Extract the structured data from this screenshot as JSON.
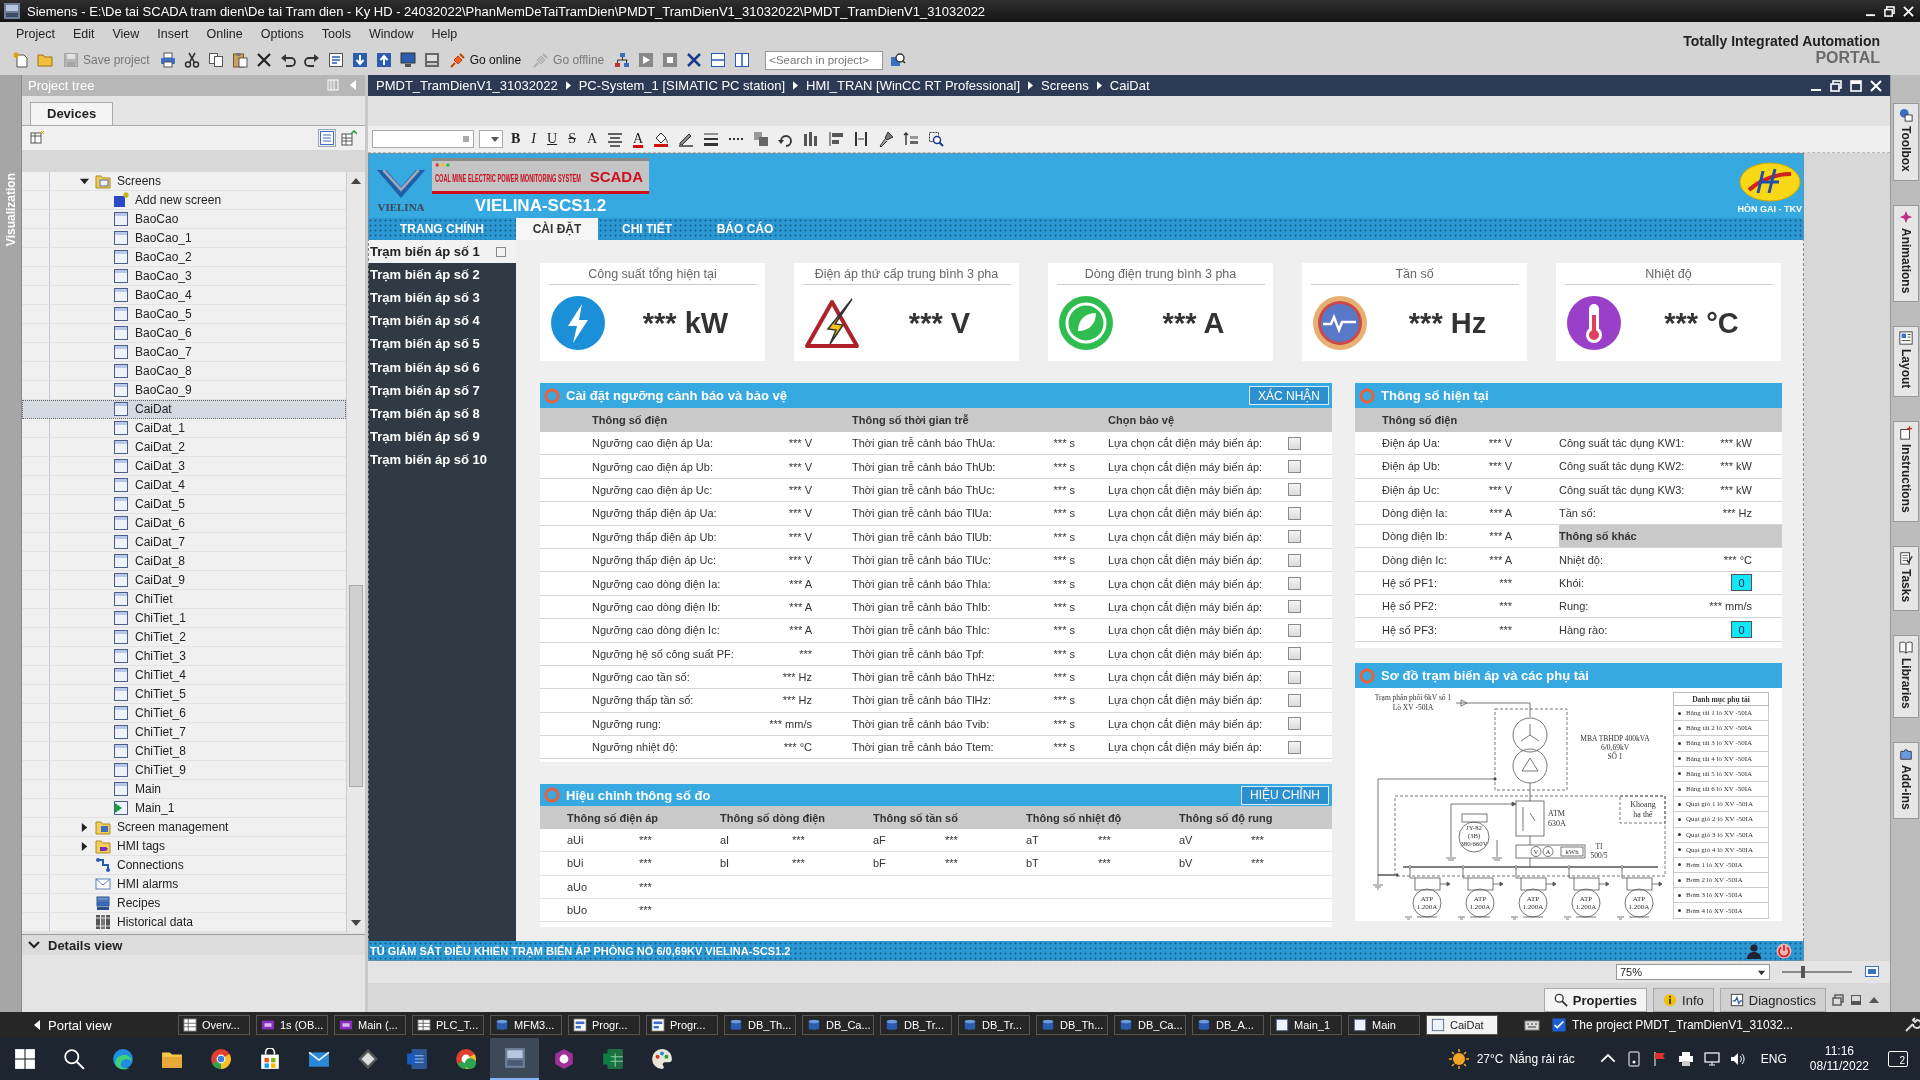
{
  "window": {
    "title": "Siemens - E:\\De tai SCADA tram dien\\De tai Tram dien - Ky HD - 24032022\\PhanMemDeTaiTramDien\\PMDT_TramDienV1_31032022\\PMDT_TramDienV1_31032022"
  },
  "menu": [
    "Project",
    "Edit",
    "View",
    "Insert",
    "Online",
    "Options",
    "Tools",
    "Window",
    "Help"
  ],
  "brand": {
    "title": "Totally Integrated Automation",
    "subtitle": "PORTAL"
  },
  "toolbar": {
    "buttons": [
      {
        "kind": "new",
        "disabled": false
      },
      {
        "kind": "open",
        "disabled": false
      },
      {
        "kind": "save",
        "label": "Save project",
        "disabled": true
      },
      {
        "kind": "print",
        "disabled": false
      },
      {
        "kind": "cut",
        "disabled": false
      },
      {
        "kind": "copy",
        "disabled": false
      },
      {
        "kind": "paste",
        "disabled": false
      },
      {
        "kind": "delete",
        "disabled": false
      },
      {
        "kind": "undo",
        "disabled": false
      },
      {
        "kind": "redo",
        "disabled": false
      },
      {
        "kind": "compile",
        "disabled": false
      },
      {
        "kind": "download",
        "disabled": false
      },
      {
        "kind": "upload",
        "disabled": false
      },
      {
        "kind": "monitor",
        "disabled": false
      },
      {
        "kind": "simulate",
        "disabled": false
      },
      {
        "kind": "online",
        "label": "Go online",
        "disabled": false
      },
      {
        "kind": "offline",
        "label": "Go offline",
        "disabled": true
      },
      {
        "kind": "devices",
        "disabled": false
      },
      {
        "kind": "start",
        "disabled": false
      },
      {
        "kind": "stop",
        "disabled": false
      },
      {
        "kind": "crossref",
        "disabled": false
      },
      {
        "kind": "split-h",
        "disabled": false
      },
      {
        "kind": "split-v",
        "disabled": false
      }
    ],
    "search": {
      "placeholder": "<Search in project>"
    }
  },
  "side_tab": "Visualization",
  "project_tree": {
    "title": "Project tree",
    "tab": {
      "label": "Devices",
      "selected": true
    },
    "items": [
      {
        "label": "Screens",
        "kind": "folder",
        "expanded": true,
        "selected": false,
        "children": [
          {
            "label": "Add new screen",
            "kind": "add-screen",
            "selected": false
          },
          {
            "label": "BaoCao",
            "kind": "screen",
            "selected": false
          },
          {
            "label": "BaoCao_1",
            "kind": "screen",
            "selected": false
          },
          {
            "label": "BaoCao_2",
            "kind": "screen",
            "selected": false
          },
          {
            "label": "BaoCao_3",
            "kind": "screen",
            "selected": false
          },
          {
            "label": "BaoCao_4",
            "kind": "screen",
            "selected": false
          },
          {
            "label": "BaoCao_5",
            "kind": "screen",
            "selected": false
          },
          {
            "label": "BaoCao_6",
            "kind": "screen",
            "selected": false
          },
          {
            "label": "BaoCao_7",
            "kind": "screen",
            "selected": false
          },
          {
            "label": "BaoCao_8",
            "kind": "screen",
            "selected": false
          },
          {
            "label": "BaoCao_9",
            "kind": "screen",
            "selected": false
          },
          {
            "label": "CaiDat",
            "kind": "screen",
            "selected": true
          },
          {
            "label": "CaiDat_1",
            "kind": "screen",
            "selected": false
          },
          {
            "label": "CaiDat_2",
            "kind": "screen",
            "selected": false
          },
          {
            "label": "CaiDat_3",
            "kind": "screen",
            "selected": false
          },
          {
            "label": "CaiDat_4",
            "kind": "screen",
            "selected": false
          },
          {
            "label": "CaiDat_5",
            "kind": "screen",
            "selected": false
          },
          {
            "label": "CaiDat_6",
            "kind": "screen",
            "selected": false
          },
          {
            "label": "CaiDat_7",
            "kind": "screen",
            "selected": false
          },
          {
            "label": "CaiDat_8",
            "kind": "screen",
            "selected": false
          },
          {
            "label": "CaiDat_9",
            "kind": "screen",
            "selected": false
          },
          {
            "label": "ChiTiet",
            "kind": "screen",
            "selected": false
          },
          {
            "label": "ChiTiet_1",
            "kind": "screen",
            "selected": false
          },
          {
            "label": "ChiTiet_2",
            "kind": "screen",
            "selected": false
          },
          {
            "label": "ChiTiet_3",
            "kind": "screen",
            "selected": false
          },
          {
            "label": "ChiTiet_4",
            "kind": "screen",
            "selected": false
          },
          {
            "label": "ChiTiet_5",
            "kind": "screen",
            "selected": false
          },
          {
            "label": "ChiTiet_6",
            "kind": "screen",
            "selected": false
          },
          {
            "label": "ChiTiet_7",
            "kind": "screen",
            "selected": false
          },
          {
            "label": "ChiTiet_8",
            "kind": "screen",
            "selected": false
          },
          {
            "label": "ChiTiet_9",
            "kind": "screen",
            "selected": false
          },
          {
            "label": "Main",
            "kind": "screen",
            "selected": false
          },
          {
            "label": "Main_1",
            "kind": "start-screen",
            "selected": false
          }
        ]
      },
      {
        "label": "Screen management",
        "kind": "screen-folder",
        "expanded": false,
        "selected": false
      },
      {
        "label": "HMI tags",
        "kind": "tags",
        "expanded": false,
        "selected": false
      },
      {
        "label": "Connections",
        "kind": "connections",
        "selected": false
      },
      {
        "label": "HMI alarms",
        "kind": "alarms",
        "selected": false
      },
      {
        "label": "Recipes",
        "kind": "recipes",
        "selected": false
      },
      {
        "label": "Historical data",
        "kind": "historical",
        "selected": false
      }
    ],
    "details": "Details view"
  },
  "editor": {
    "breadcrumb": [
      "PMDT_TramDienV1_31032022",
      "PC-System_1 [SIMATIC PC station]",
      "HMI_TRAN [WinCC RT Professional]",
      "Screens",
      "CaiDat"
    ],
    "format_buttons": [
      {
        "kind": "bold",
        "label": "B"
      },
      {
        "kind": "italic",
        "label": "I"
      },
      {
        "kind": "underline",
        "label": "U"
      },
      {
        "kind": "strike",
        "label": "S"
      },
      {
        "kind": "grow",
        "label": "A"
      },
      {
        "kind": "align"
      },
      {
        "kind": "text-color",
        "label": "A"
      },
      {
        "kind": "fill"
      },
      {
        "kind": "pen"
      },
      {
        "kind": "line-width"
      },
      {
        "kind": "dash"
      },
      {
        "kind": "arrange"
      },
      {
        "kind": "rotate"
      },
      {
        "kind": "distribute"
      },
      {
        "kind": "align-objects"
      },
      {
        "kind": "spacing"
      },
      {
        "kind": "brush"
      },
      {
        "kind": "layers"
      },
      {
        "kind": "zoom-area"
      }
    ],
    "zoom": {
      "value": "75%",
      "level": 0.3
    }
  },
  "hmi": {
    "logo_text": "VIELINA",
    "banner": {
      "subtitle": "COAL MINE ELECTRIC POWER MONITORING SYSTEM",
      "badge": "SCADA"
    },
    "product": "VIELINA-SCS1.2",
    "emblem_text": "HÒN GAI - TKV",
    "nav_tabs": [
      {
        "label": "TRANG CHÍNH",
        "selected": false
      },
      {
        "label": "CÀI ĐẶT",
        "selected": true
      },
      {
        "label": "CHI TIẾT",
        "selected": false
      },
      {
        "label": "BÁO CÁO",
        "selected": false
      }
    ],
    "stations": [
      {
        "label": "Trạm biến áp số 1",
        "selected": true
      },
      {
        "label": "Trạm biến áp số 2",
        "selected": false
      },
      {
        "label": "Trạm biến áp số 3",
        "selected": false
      },
      {
        "label": "Trạm biến áp số 4",
        "selected": false
      },
      {
        "label": "Trạm biến áp số 5",
        "selected": false
      },
      {
        "label": "Trạm biến áp số 6",
        "selected": false
      },
      {
        "label": "Trạm biến áp số 7",
        "selected": false
      },
      {
        "label": "Trạm biến áp số 8",
        "selected": false
      },
      {
        "label": "Trạm biến áp số 9",
        "selected": false
      },
      {
        "label": "Trạm biến áp số 10",
        "selected": false
      }
    ],
    "kpis": [
      {
        "title": "Công suất tổng hiện tại",
        "value": "*** kW",
        "kind": "power"
      },
      {
        "title": "Điện áp thứ cấp trung bình 3 pha",
        "value": "*** V",
        "kind": "voltage"
      },
      {
        "title": "Dòng điện trung bình 3 pha",
        "value": "*** A",
        "kind": "current"
      },
      {
        "title": "Tần số",
        "value": "*** Hz",
        "kind": "frequency"
      },
      {
        "title": "Nhiệt độ",
        "value": "*** °C",
        "kind": "temperature"
      }
    ],
    "settings": {
      "title": "Cài đặt ngưỡng cảnh báo và bảo vệ",
      "button": "XÁC NHẬN",
      "columns": [
        "Thông số điện",
        "Thông số thời gian trễ",
        "Chọn bảo vệ"
      ],
      "rows": [
        {
          "param": "Ngưỡng cao điện áp Ua:",
          "value": "*** V",
          "delay": "Thời gian trễ cảnh báo ThUa:",
          "delay_value": "*** s",
          "protect": "Lựa chọn cắt điện máy biến áp:",
          "checked": false
        },
        {
          "param": "Ngưỡng cao điện áp Ub:",
          "value": "*** V",
          "delay": "Thời gian trễ cảnh báo ThUb:",
          "delay_value": "*** s",
          "protect": "Lựa chọn cắt điện máy biến áp:",
          "checked": false
        },
        {
          "param": "Ngưỡng cao điện áp Uc:",
          "value": "*** V",
          "delay": "Thời gian trễ cảnh báo ThUc:",
          "delay_value": "*** s",
          "protect": "Lựa chọn cắt điện máy biến áp:",
          "checked": false
        },
        {
          "param": "Ngưỡng thấp điện áp Ua:",
          "value": "*** V",
          "delay": "Thời gian trễ cảnh báo TlUa:",
          "delay_value": "*** s",
          "protect": "Lựa chọn cắt điện máy biến áp:",
          "checked": false
        },
        {
          "param": "Ngưỡng thấp điện áp Ub:",
          "value": "*** V",
          "delay": "Thời gian trễ cảnh báo TlUb:",
          "delay_value": "*** s",
          "protect": "Lựa chọn cắt điện máy biến áp:",
          "checked": false
        },
        {
          "param": "Ngưỡng thấp điện áp Uc:",
          "value": "*** V",
          "delay": "Thời gian trễ cảnh báo TlUc:",
          "delay_value": "*** s",
          "protect": "Lựa chọn cắt điện máy biến áp:",
          "checked": false
        },
        {
          "param": "Ngưỡng cao dòng điện Ia:",
          "value": "*** A",
          "delay": "Thời gian trễ cảnh báo ThIa:",
          "delay_value": "*** s",
          "protect": "Lựa chọn cắt điện máy biến áp:",
          "checked": false
        },
        {
          "param": "Ngưỡng cao dòng điện Ib:",
          "value": "*** A",
          "delay": "Thời gian trễ cảnh báo ThIb:",
          "delay_value": "*** s",
          "protect": "Lựa chọn cắt điện máy biến áp:",
          "checked": false
        },
        {
          "param": "Ngưỡng cao dòng điện Ic:",
          "value": "*** A",
          "delay": "Thời gian trễ cảnh báo ThIc:",
          "delay_value": "*** s",
          "protect": "Lựa chọn cắt điện máy biến áp:",
          "checked": false
        },
        {
          "param": "Ngưỡng hệ số công suất PF:",
          "value": "***",
          "delay": "Thời gian trễ cảnh báo Tpf:",
          "delay_value": "*** s",
          "protect": "Lựa chọn cắt điện máy biến áp:",
          "checked": false
        },
        {
          "param": "Ngưỡng cao tần số:",
          "value": "*** Hz",
          "delay": "Thời gian trễ cảnh báo ThHz:",
          "delay_value": "*** s",
          "protect": "Lựa chọn cắt điện máy biến áp:",
          "checked": false
        },
        {
          "param": "Ngưỡng thấp tần số:",
          "value": "*** Hz",
          "delay": "Thời gian trễ cảnh báo TlHz:",
          "delay_value": "*** s",
          "protect": "Lựa chọn cắt điện máy biến áp:",
          "checked": false
        },
        {
          "param": "Ngưỡng rung:",
          "value": "*** mm/s",
          "delay": "Thời gian trễ cảnh báo Tvib:",
          "delay_value": "*** s",
          "protect": "Lựa chọn cắt điện máy biến áp:",
          "checked": false
        },
        {
          "param": "Ngưỡng nhiệt độ:",
          "value": "*** °C",
          "delay": "Thời gian trễ cảnh báo Ttem:",
          "delay_value": "*** s",
          "protect": "Lựa chọn cắt điện máy biến áp:",
          "checked": false
        }
      ]
    },
    "calibration": {
      "title": "Hiệu chỉnh thông số đo",
      "button": "HIỆU CHỈNH",
      "columns": [
        "Thông số điện áp",
        "Thông số dòng điện",
        "Thông số tần số",
        "Thông số nhiệt độ",
        "Thông số độ rung"
      ],
      "rows": [
        [
          {
            "label": "aUi",
            "value": "***"
          },
          {
            "label": "aI",
            "value": "***"
          },
          {
            "label": "aF",
            "value": "***"
          },
          {
            "label": "aT",
            "value": "***"
          },
          {
            "label": "aV",
            "value": "***"
          }
        ],
        [
          {
            "label": "bUi",
            "value": "***"
          },
          {
            "label": "bI",
            "value": "***"
          },
          {
            "label": "bF",
            "value": "***"
          },
          {
            "label": "bT",
            "value": "***"
          },
          {
            "label": "bV",
            "value": "***"
          }
        ],
        [
          {
            "label": "aUo",
            "value": "***"
          }
        ],
        [
          {
            "label": "bUo",
            "value": "***"
          }
        ]
      ]
    },
    "current": {
      "title": "Thông số hiện tại",
      "section": "Thông số điện",
      "rows": [
        {
          "left": {
            "label": "Điện áp Ua:",
            "value": "*** V"
          },
          "right": {
            "kind": "reading",
            "label": "Công suất tác dụng KW1:",
            "value": "*** kW"
          }
        },
        {
          "left": {
            "label": "Điện áp Ub:",
            "value": "*** V"
          },
          "right": {
            "kind": "reading",
            "label": "Công suất tác dụng KW2:",
            "value": "*** kW"
          }
        },
        {
          "left": {
            "label": "Điện áp Uc:",
            "value": "*** V"
          },
          "right": {
            "kind": "reading",
            "label": "Công suất tác dụng KW3:",
            "value": "*** kW"
          }
        },
        {
          "left": {
            "label": "Dòng điện Ia:",
            "value": "*** A"
          },
          "right": {
            "kind": "reading",
            "label": "Tần số:",
            "value": "*** Hz"
          }
        },
        {
          "left": {
            "label": "Dòng điện Ib:",
            "value": "*** A"
          },
          "right": {
            "kind": "section",
            "label": "Thông số khác"
          }
        },
        {
          "left": {
            "label": "Dòng điện Ic:",
            "value": "*** A"
          },
          "right": {
            "kind": "reading",
            "label": "Nhiệt độ:",
            "value": "*** °C"
          }
        },
        {
          "left": {
            "label": "Hệ số PF1:",
            "value": "***"
          },
          "right": {
            "kind": "indicator",
            "label": "Khói:",
            "value": "0"
          }
        },
        {
          "left": {
            "label": "Hệ số PF2:",
            "value": "***"
          },
          "right": {
            "kind": "reading",
            "label": "Rung:",
            "value": "*** mm/s"
          }
        },
        {
          "left": {
            "label": "Hệ số PF3:",
            "value": "***"
          },
          "right": {
            "kind": "indicator",
            "label": "Hàng rào:",
            "value": "0"
          }
        }
      ]
    },
    "diagram": {
      "title": "Sơ đồ trạm biến áp và các phụ tải",
      "labels": [
        "Trạm phân phối 6kV số 1",
        "Lò XV -50IA",
        "MBA TBHDP 400kVA",
        "6/0,69kV",
        "SỐ 1",
        "ATM",
        "630A",
        "Khoang",
        "hạ thế",
        "JY-82",
        "(3B)",
        "380/660V",
        "TI",
        "500/5",
        "V",
        "A",
        "kWh",
        "ATP",
        "1.200A",
        "ATP",
        "1.200A",
        "ATP",
        "1.200A",
        "ATP",
        "1.200A",
        "ATP",
        "1.200A"
      ],
      "load_list": {
        "title": "Danh mục phụ tải",
        "items": [
          "Băng tải 1 lò XV -50IA",
          "Băng tải 2 lò XV -50IA",
          "Băng tải 3 lò XV -50IA",
          "Băng tải 4 lò XV -50IA",
          "Băng tải 5 lò XV -50IA",
          "Băng tải 6 lò XV -50IA",
          "Quạt gió 1 lò XV -50IA",
          "Quạt gió 2 lò XV -50IA",
          "Quạt gió 3 lò XV -50IA",
          "Quạt gió 4 lò XV -50IA",
          "Bơm 1 lò XV -50IA",
          "Bơm 2 lò XV -50IA",
          "Bơm 3 lò XV -50IA",
          "Bơm 4 lò XV -50IA"
        ]
      }
    },
    "status_bar": "TỦ GIÁM SÁT ĐIỀU KHIỂN TRẠM BIẾN ÁP PHÒNG NỔ 6/0,69KV VIELINA-SCS1.2"
  },
  "right_tabs": [
    {
      "label": "Toolbox",
      "kind": "toolbox"
    },
    {
      "label": "Animations",
      "kind": "animations"
    },
    {
      "label": "Layout",
      "kind": "layout"
    },
    {
      "label": "Instructions",
      "kind": "instructions"
    },
    {
      "label": "Tasks",
      "kind": "tasks"
    },
    {
      "label": "Libraries",
      "kind": "libraries"
    },
    {
      "label": "Add-ins",
      "kind": "addins"
    }
  ],
  "inspector": {
    "tabs": [
      {
        "label": "Properties",
        "kind": "properties",
        "selected": true
      },
      {
        "label": "Info",
        "kind": "info",
        "selected": false
      },
      {
        "label": "Diagnostics",
        "kind": "diagnostics",
        "selected": false
      }
    ]
  },
  "portal_bar": {
    "portal_view": "Portal view",
    "tasks": [
      {
        "label": "Overv...",
        "kind": "overview",
        "selected": false
      },
      {
        "label": "1s (OB...",
        "kind": "block",
        "selected": false
      },
      {
        "label": "Main (...",
        "kind": "block",
        "selected": false
      },
      {
        "label": "PLC_T...",
        "kind": "table",
        "selected": false
      },
      {
        "label": "MFM3...",
        "kind": "db",
        "selected": false
      },
      {
        "label": "Progr...",
        "kind": "program",
        "selected": false
      },
      {
        "label": "Progr...",
        "kind": "program",
        "selected": false
      },
      {
        "label": "DB_Th...",
        "kind": "db",
        "selected": false
      },
      {
        "label": "DB_Ca...",
        "kind": "db",
        "selected": false
      },
      {
        "label": "DB_Tr...",
        "kind": "db",
        "selected": false
      },
      {
        "label": "DB_Tr...",
        "kind": "db",
        "selected": false
      },
      {
        "label": "DB_Th...",
        "kind": "db",
        "selected": false
      },
      {
        "label": "DB_Ca...",
        "kind": "db",
        "selected": false
      },
      {
        "label": "DB_A...",
        "kind": "db",
        "selected": false
      },
      {
        "label": "Main_1",
        "kind": "screen",
        "selected": false
      },
      {
        "label": "Main",
        "kind": "screen",
        "selected": false
      },
      {
        "label": "CaiDat",
        "kind": "screen",
        "selected": true
      }
    ],
    "status": "The project PMDT_TramDienV1_31032..."
  },
  "taskbar": {
    "apps": [
      {
        "kind": "start",
        "active": false
      },
      {
        "kind": "search",
        "active": false
      },
      {
        "kind": "edge",
        "active": false
      },
      {
        "kind": "explorer",
        "active": false
      },
      {
        "kind": "chrome",
        "active": false
      },
      {
        "kind": "store",
        "active": false
      },
      {
        "kind": "mail",
        "active": false
      },
      {
        "kind": "diamond",
        "active": false
      },
      {
        "kind": "word",
        "active": false
      },
      {
        "kind": "chrome2",
        "active": false
      },
      {
        "kind": "tia",
        "active": true
      },
      {
        "kind": "hexagon",
        "active": false
      },
      {
        "kind": "excel",
        "active": false
      },
      {
        "kind": "paint",
        "active": false
      }
    ],
    "weather": {
      "temperature": "27°C",
      "condition": "Nắng rải rác"
    },
    "language": "ENG",
    "time": "11:16",
    "date": "08/11/2022",
    "notifications": "2"
  }
}
